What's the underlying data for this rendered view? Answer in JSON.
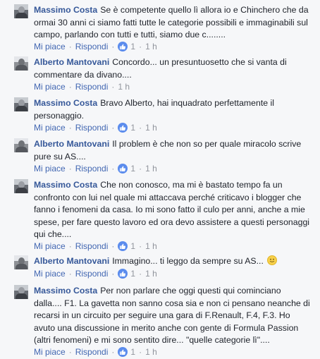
{
  "comments": [
    {
      "author": "Massimo Costa",
      "text": "Se è competente quello lì allora io e Chinchero che da ormai 30 anni ci siamo fatti tutte le categorie possibili e immaginabili sul campo, parlando con tutti e tutti, siamo due c........",
      "like_label": "Mi piace",
      "reply_label": "Rispondi",
      "likes": "1",
      "time": "1 h",
      "has_likes": true
    },
    {
      "author": "Alberto Mantovani",
      "text": "Concordo... un presuntuosetto che si vanta di commentare da divano....",
      "like_label": "Mi piace",
      "reply_label": "Rispondi",
      "time": "1 h",
      "has_likes": false
    },
    {
      "author": "Massimo Costa",
      "text": "Bravo Alberto, hai inquadrato perfettamente il personaggio.",
      "like_label": "Mi piace",
      "reply_label": "Rispondi",
      "likes": "1",
      "time": "1 h",
      "has_likes": true
    },
    {
      "author": "Alberto Mantovani",
      "text": "Il problem è che non so per quale miracolo scrive pure su AS....",
      "like_label": "Mi piace",
      "reply_label": "Rispondi",
      "likes": "1",
      "time": "1 h",
      "has_likes": true
    },
    {
      "author": "Massimo Costa",
      "text": "Che non conosco, ma mi è bastato tempo fa un confronto con lui nel quale mi attaccava perché criticavo i blogger che fanno i fenomeni da casa. Io mi sono fatto il culo per anni, anche a mie spese, per fare questo lavoro ed ora devo assistere a questi personaggi qui che....",
      "like_label": "Mi piace",
      "reply_label": "Rispondi",
      "likes": "1",
      "time": "1 h",
      "has_likes": true
    },
    {
      "author": "Alberto Mantovani",
      "text": "Immagino... ti leggo da sempre su AS...",
      "emoji": "smile-emoji",
      "like_label": "Mi piace",
      "reply_label": "Rispondi",
      "likes": "1",
      "time": "1 h",
      "has_likes": true
    },
    {
      "author": "Massimo Costa",
      "text": "Per non parlare che oggi questi qui cominciano dalla.... F1. La gavetta non sanno cosa sia e non ci pensano neanche di recarsi in un circuito per seguire una gara di F.Renault, F.4, F.3. Ho avuto una discussione in merito anche con gente di Formula Passion (altri fenomeni) e mi sono sentito dire... \"quelle categorie lì\"....",
      "like_label": "Mi piace",
      "reply_label": "Rispondi",
      "likes": "1",
      "time": "1 h",
      "has_likes": true
    }
  ],
  "icons": {
    "like": "thumbs-up-icon",
    "avatar": "profile-photo"
  },
  "colors": {
    "author": "#365899",
    "link": "#4267b2",
    "meta": "#90949c",
    "like_badge": "#5b8ced",
    "background": "#f6f7f9"
  }
}
